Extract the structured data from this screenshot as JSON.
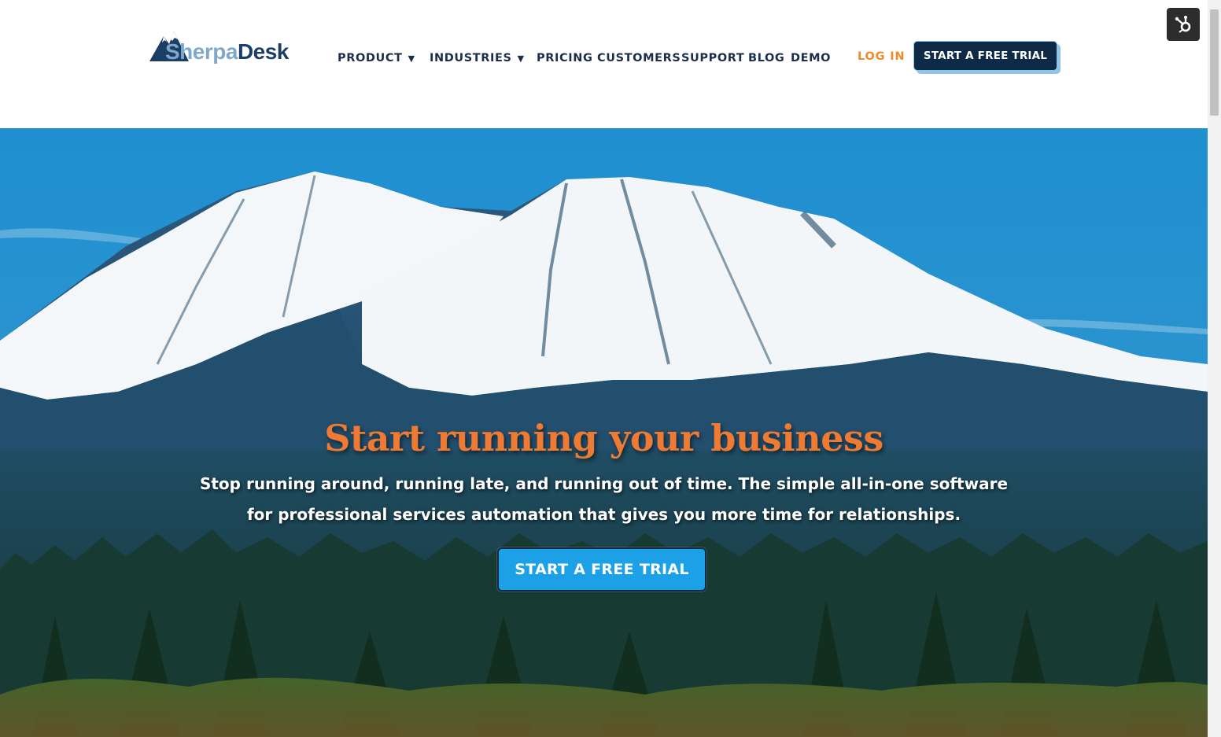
{
  "brand": {
    "name_part1": "Sherpa",
    "name_part2": "Desk"
  },
  "nav": {
    "items": [
      {
        "label": "PRODUCT",
        "dropdown": true
      },
      {
        "label": "INDUSTRIES",
        "dropdown": true
      },
      {
        "label": "PRICING",
        "dropdown": false
      },
      {
        "label": "CUSTOMERS",
        "dropdown": false
      },
      {
        "label": "SUPPORT",
        "dropdown": false
      },
      {
        "label": "BLOG",
        "dropdown": false
      },
      {
        "label": "DEMO",
        "dropdown": false
      }
    ],
    "caret": "▼",
    "login_label": "LOG IN",
    "trial_label": "START A FREE TRIAL"
  },
  "hero": {
    "title": "Start running your business",
    "subtitle": "Stop running around, running late, and running out of time. The simple all-in-one software for professional services automation that gives you more time for relationships.",
    "cta_label": "START A FREE TRIAL"
  },
  "colors": {
    "brand_navy": "#0e2a47",
    "accent_orange": "#ee7a33",
    "cta_blue": "#1da1e6",
    "nav_text": "#1b2f4a"
  },
  "icons": {
    "hubspot_widget": "hubspot-icon",
    "logo_mark": "mountain-logo-icon"
  }
}
